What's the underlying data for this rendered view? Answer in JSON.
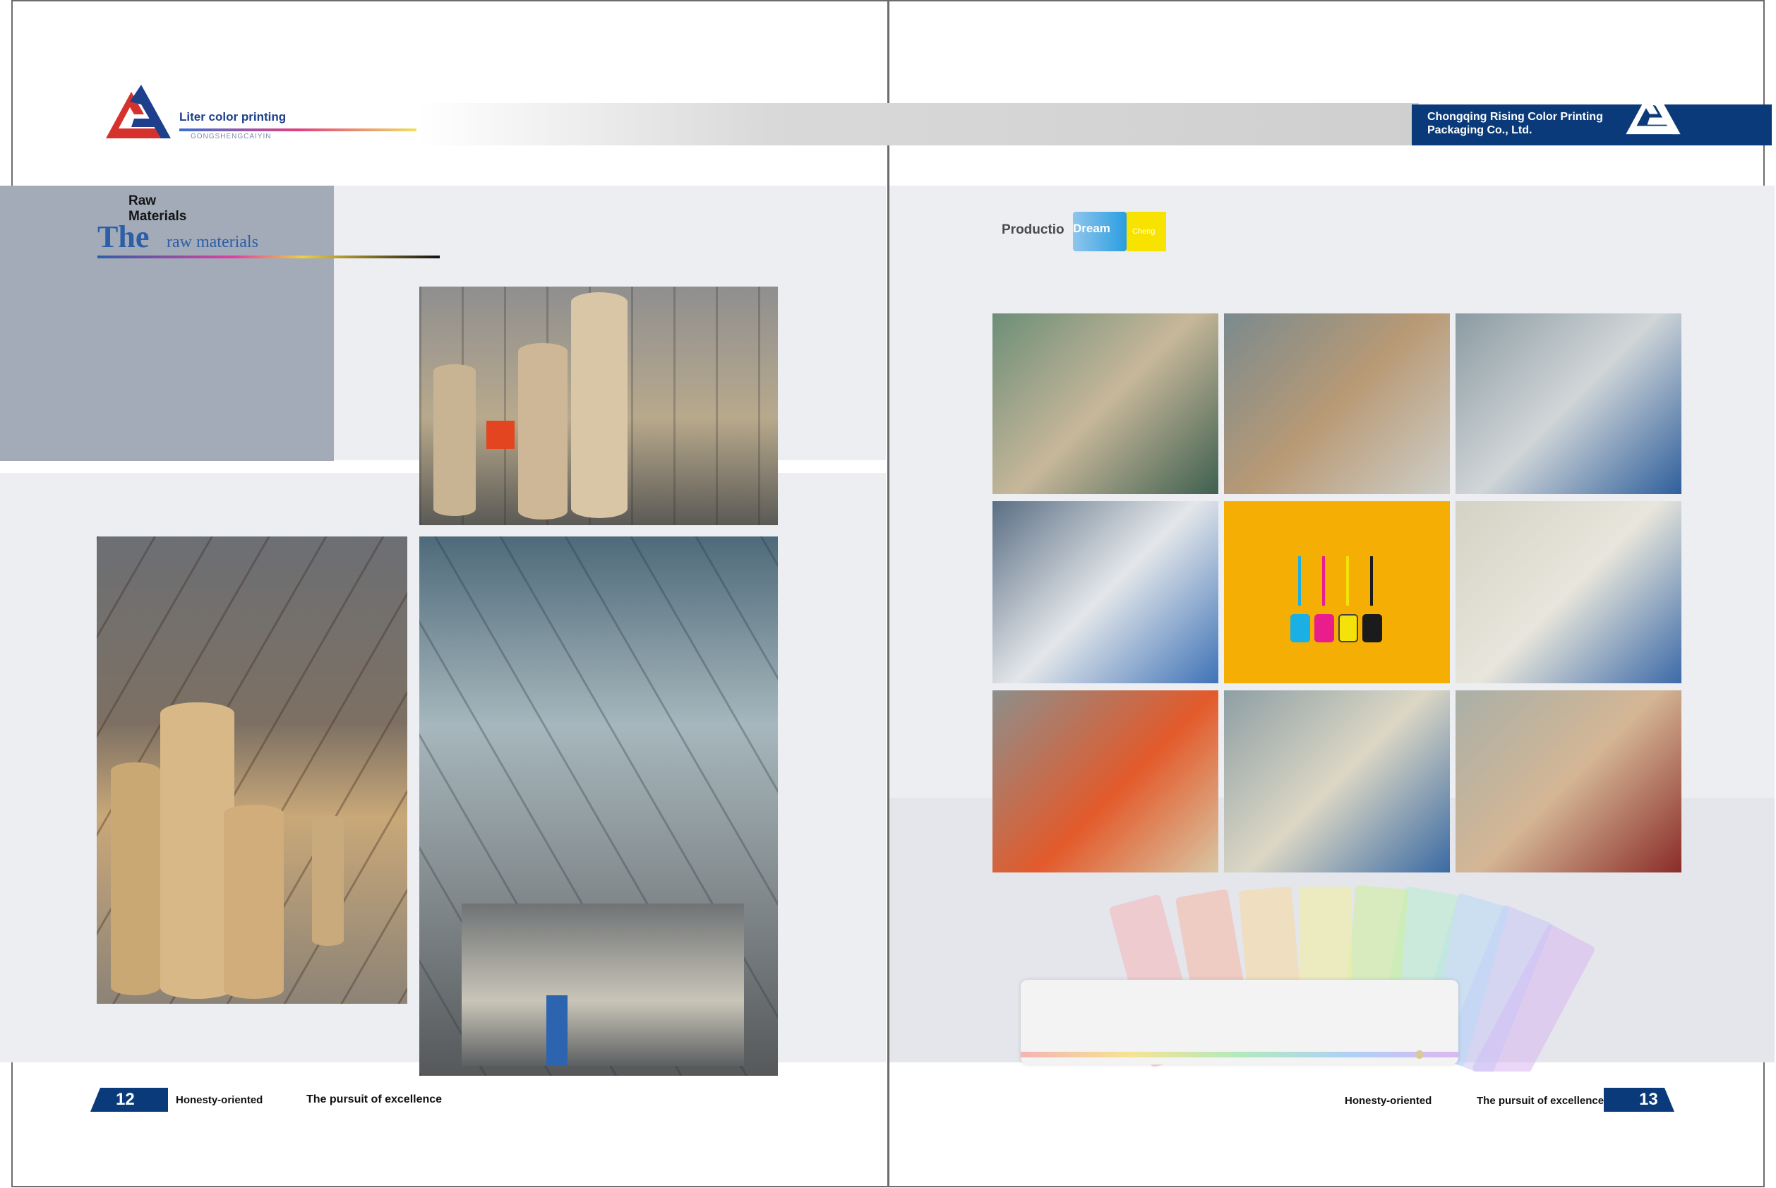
{
  "left_page": {
    "logo": {
      "name": "Liter color printing",
      "sub": "GONGSHENGCAIYIN"
    },
    "section": {
      "line1": "Raw",
      "line2": "Materials",
      "the": "The",
      "subtitle": "raw materials"
    },
    "footer": {
      "page": "12",
      "slogan1": "Honesty-oriented",
      "slogan2": "The pursuit of excellence"
    }
  },
  "right_page": {
    "company": {
      "line1": "Chongqing Rising Color Printing",
      "line2": "Packaging Co., Ltd."
    },
    "production": {
      "label": "Productio",
      "tab1": "Dream",
      "tab2": "Cheng"
    },
    "footer": {
      "page": "13",
      "slogan1": "Honesty-oriented",
      "slogan2": "The pursuit of excellence"
    }
  },
  "colors": {
    "brand_blue": "#0b3a7a",
    "logo_red": "#d6322d",
    "accent_yellow": "#f5ae04",
    "band_gray": "#edeef2",
    "block_gray": "#a2abb7"
  },
  "icons": [
    "company-logo-icon",
    "ink-bottles-icon",
    "color-fan-icon"
  ]
}
